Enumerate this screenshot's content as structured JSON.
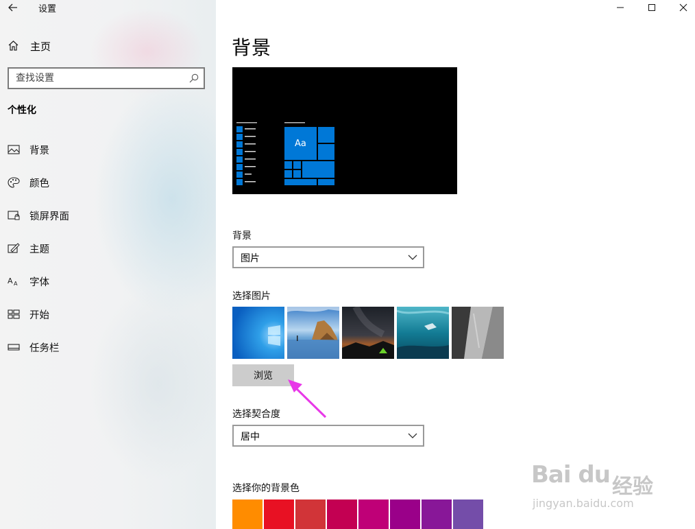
{
  "window": {
    "app_title": "设置",
    "controls": [
      "minimize",
      "maximize",
      "close"
    ]
  },
  "sidebar": {
    "home_label": "主页",
    "search_placeholder": "查找设置",
    "section_title": "个性化",
    "items": [
      {
        "label": "背景",
        "icon": "picture-icon"
      },
      {
        "label": "颜色",
        "icon": "palette-icon"
      },
      {
        "label": "锁屏界面",
        "icon": "lock-screen-icon"
      },
      {
        "label": "主题",
        "icon": "theme-icon"
      },
      {
        "label": "字体",
        "icon": "font-icon"
      },
      {
        "label": "开始",
        "icon": "start-icon"
      },
      {
        "label": "任务栏",
        "icon": "taskbar-icon"
      }
    ]
  },
  "main": {
    "title": "背景",
    "preview_tile_text": "Aa",
    "background_label": "背景",
    "background_value": "图片",
    "choose_picture_label": "选择图片",
    "browse_label": "浏览",
    "fit_label": "选择契合度",
    "fit_value": "居中",
    "bg_color_label": "选择你的背景色",
    "swatch_colors": [
      "#ff8c00",
      "#e81123",
      "#d13438",
      "#c30052",
      "#bf0077",
      "#9a0089",
      "#881798",
      "#744da9"
    ]
  },
  "watermark": {
    "logo": "Bai du",
    "cn": "经验",
    "url": "jingyan.baidu.com"
  },
  "colors": {
    "accent": "#0078d7",
    "arrow": "#e838e8"
  }
}
